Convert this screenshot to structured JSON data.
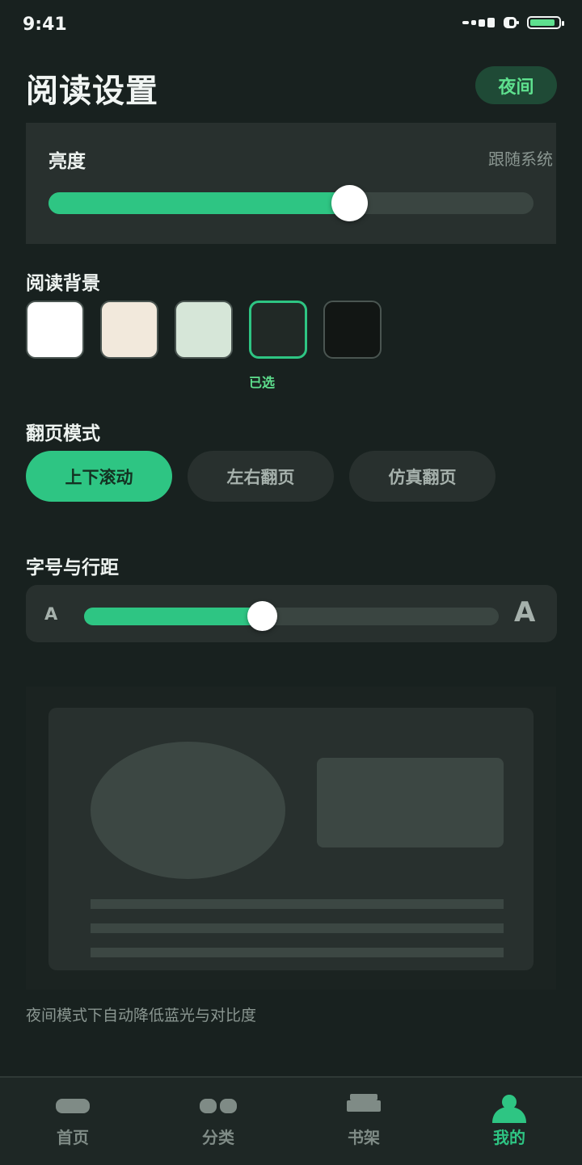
{
  "status": {
    "time": "9:41"
  },
  "header": {
    "title": "阅读设置",
    "night_label": "夜间"
  },
  "brightness": {
    "label": "亮度",
    "follow_system": "跟随系统",
    "value": 0.62
  },
  "background": {
    "label": "阅读背景",
    "selected_label": "已选",
    "swatches": [
      "#ffffff",
      "#f2e9dc",
      "#d6e6d8",
      "#212926",
      "#121614"
    ],
    "selected_index": 3
  },
  "page_mode": {
    "label": "翻页模式",
    "options": [
      "上下滚动",
      "左右翻页",
      "仿真翻页"
    ],
    "active_index": 0
  },
  "font": {
    "label": "字号与行距",
    "small_glyph": "A",
    "large_glyph": "A",
    "value": 0.43
  },
  "hint": "夜间模式下自动降低蓝光与对比度",
  "tabs": [
    {
      "label": "首页",
      "icon": "home-icon"
    },
    {
      "label": "分类",
      "icon": "category-icon"
    },
    {
      "label": "书架",
      "icon": "bookshelf-icon"
    },
    {
      "label": "我的",
      "icon": "profile-icon",
      "active": true
    }
  ],
  "colors": {
    "accent": "#2ec583",
    "background": "#18211f",
    "card": "#28302e"
  }
}
